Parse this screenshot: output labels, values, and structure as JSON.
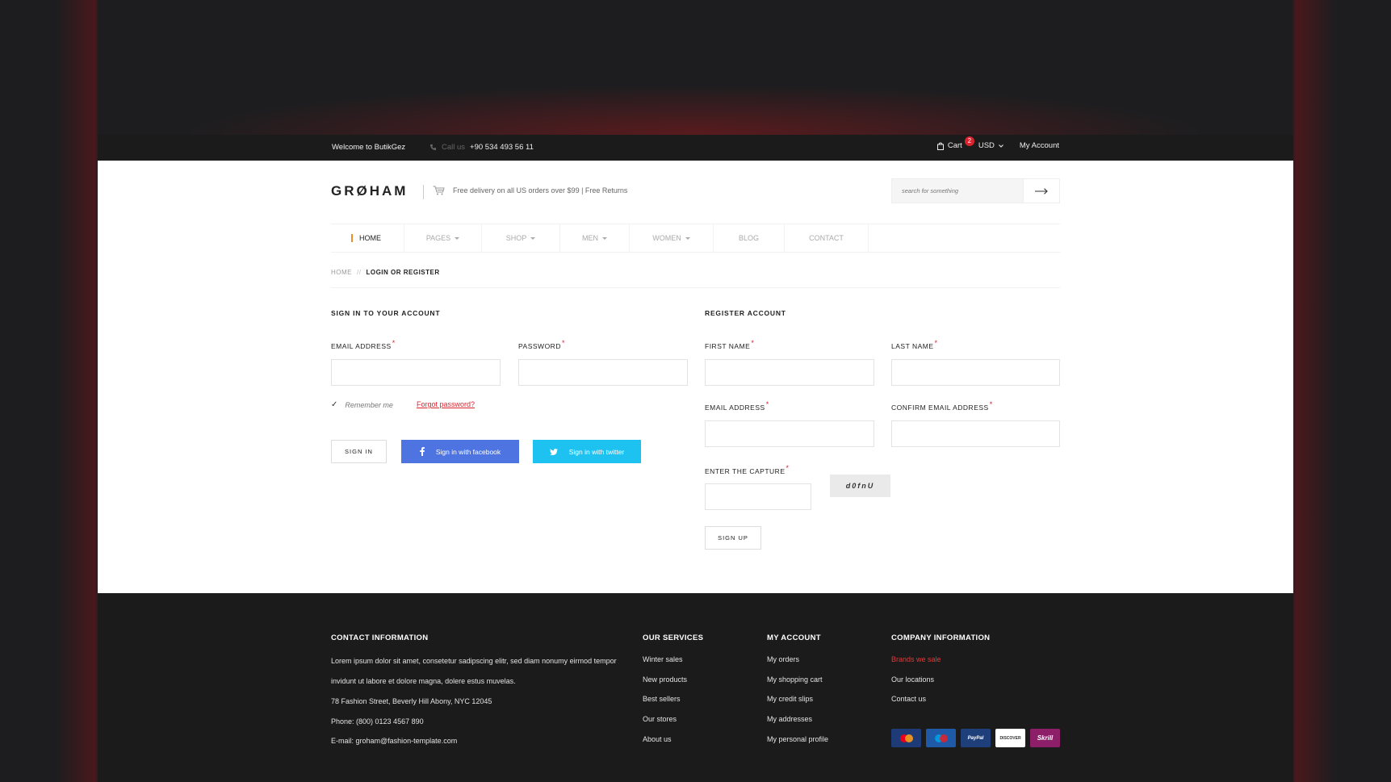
{
  "topbar": {
    "welcome": "Welcome to ButikGez",
    "call_label": "Call us",
    "phone": "+90 534 493 56 11",
    "cart_label": "Cart",
    "cart_count": "2",
    "currency": "USD",
    "my_account": "My Account"
  },
  "header": {
    "logo": "GRØHAM",
    "promo": "Free delivery on all US orders over $99  |  Free Returns",
    "search_placeholder": "search for something"
  },
  "nav": {
    "items": [
      {
        "label": "HOME",
        "active": true
      },
      {
        "label": "PAGES",
        "dropdown": true
      },
      {
        "label": "SHOP",
        "dropdown": true
      },
      {
        "label": "MEN",
        "dropdown": true
      },
      {
        "label": "WOMEN",
        "dropdown": true
      },
      {
        "label": "BLOG"
      },
      {
        "label": "CONTACT"
      }
    ]
  },
  "breadcrumb": {
    "home": "HOME",
    "sep": "//",
    "current": "LOGIN OR REGISTER"
  },
  "signin": {
    "title": "SIGN IN TO YOUR ACCOUNT",
    "email_label": "EMAIL ADDRESS",
    "password_label": "PASSWORD",
    "remember": "Remember me",
    "forgot": "Forgot password?",
    "signin_btn": "SIGN IN",
    "facebook_btn": "Sign in with facebook",
    "twitter_btn": "Sign in with twitter"
  },
  "register": {
    "title": "REGISTER ACCOUNT",
    "first_name": "FIRST NAME",
    "last_name": "LAST NAME",
    "email": "EMAIL ADDRESS",
    "confirm_email": "CONFIRM EMAIL ADDRESS",
    "capture_label": "ENTER THE CAPTURE",
    "captcha_text": "d0fnU",
    "signup_btn": "SIGN UP"
  },
  "footer": {
    "contact": {
      "title": "CONTACT INFORMATION",
      "lorem": "Lorem ipsum dolor sit amet, consetetur sadipscing elitr, sed diam nonumy eirmod tempor invidunt ut labore et dolore magna, dolere estus muvelas.",
      "address": "78 Fashion Street, Beverly Hill Abony, NYC 12045",
      "phone": "Phone: (800) 0123 4567 890",
      "email": "E-mail:  groham@fashion-template.com"
    },
    "services": {
      "title": "OUR SERVICES",
      "items": [
        "Winter sales",
        "New products",
        "Best sellers",
        "Our stores",
        "About us"
      ]
    },
    "account": {
      "title": "MY ACCOUNT",
      "items": [
        "My orders",
        "My shopping cart",
        "My credit slips",
        "My addresses",
        "My personal profile"
      ]
    },
    "company": {
      "title": "COMPANY INFORMATION",
      "items": [
        "Brands we sale",
        "Our locations",
        "Contact us"
      ]
    },
    "payments": [
      {
        "name": "MasterCard",
        "color": "#1e3b78"
      },
      {
        "name": "Maestro",
        "color": "#1e5aa8"
      },
      {
        "name": "PayPal",
        "color": "#1f3f7a"
      },
      {
        "name": "DISCOVER",
        "color": "#ffffff"
      },
      {
        "name": "Skrill",
        "color": "#8c1f68"
      }
    ]
  }
}
